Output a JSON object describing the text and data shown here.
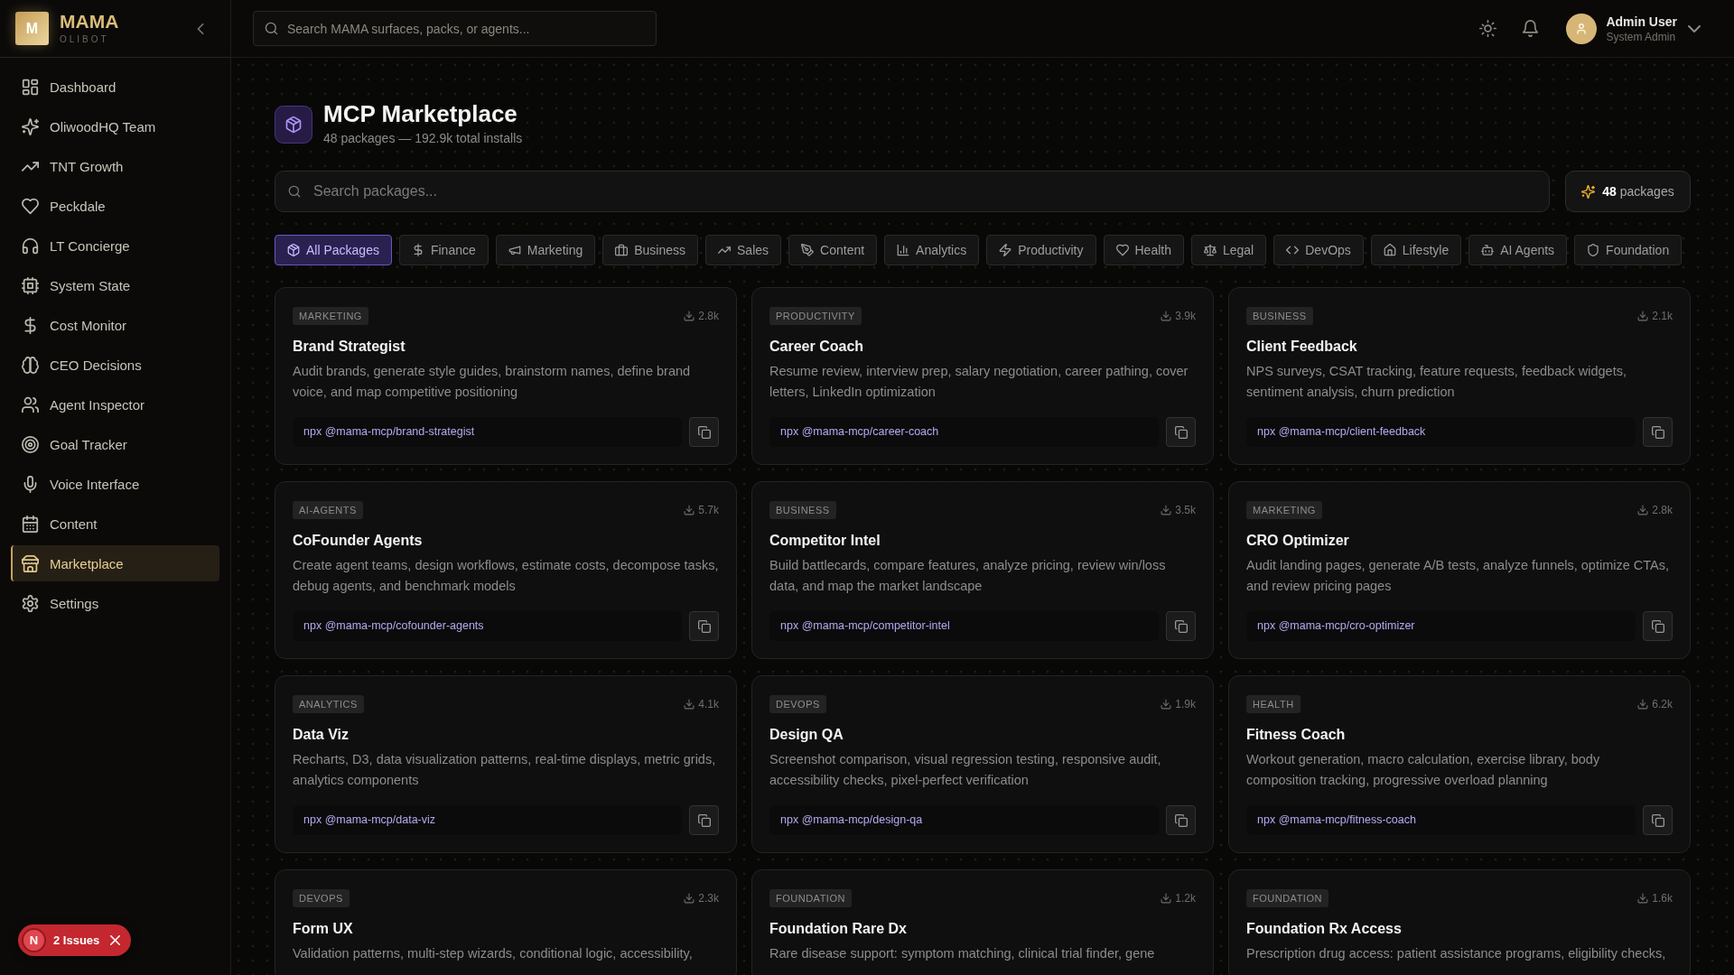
{
  "sidebar": {
    "brand": {
      "logo_letter": "M",
      "name": "MAMA",
      "subtitle": "OLIBOT"
    },
    "items": [
      {
        "label": "Dashboard",
        "selected": false
      },
      {
        "label": "OliwoodHQ Team",
        "selected": false
      },
      {
        "label": "TNT Growth",
        "selected": false
      },
      {
        "label": "Peckdale",
        "selected": false
      },
      {
        "label": "LT Concierge",
        "selected": false
      },
      {
        "label": "System State",
        "selected": false
      },
      {
        "label": "Cost Monitor",
        "selected": false
      },
      {
        "label": "CEO Decisions",
        "selected": false
      },
      {
        "label": "Agent Inspector",
        "selected": false
      },
      {
        "label": "Goal Tracker",
        "selected": false
      },
      {
        "label": "Voice Interface",
        "selected": false
      },
      {
        "label": "Content",
        "selected": false
      },
      {
        "label": "Marketplace",
        "selected": true
      },
      {
        "label": "Settings",
        "selected": false
      }
    ]
  },
  "topbar": {
    "search": {
      "placeholder": "Search MAMA surfaces, packs, or agents..."
    },
    "user": {
      "name": "Admin User",
      "role": "System Admin"
    }
  },
  "page": {
    "title": "MCP Marketplace",
    "subtitle": "48 packages — 192.9k total installs"
  },
  "search": {
    "placeholder": "Search packages..."
  },
  "count_button": "**48** packages",
  "filters": [
    {
      "label": "All Packages",
      "selected": true
    },
    {
      "label": "Finance",
      "selected": false
    },
    {
      "label": "Marketing",
      "selected": false
    },
    {
      "label": "Business",
      "selected": false
    },
    {
      "label": "Sales",
      "selected": false
    },
    {
      "label": "Content",
      "selected": false
    },
    {
      "label": "Analytics",
      "selected": false
    },
    {
      "label": "Productivity",
      "selected": false
    },
    {
      "label": "Health",
      "selected": false
    },
    {
      "label": "Legal",
      "selected": false
    },
    {
      "label": "DevOps",
      "selected": false
    },
    {
      "label": "Lifestyle",
      "selected": false
    },
    {
      "label": "AI Agents",
      "selected": false
    },
    {
      "label": "Foundation",
      "selected": false
    }
  ],
  "packages": [
    {
      "category": "MARKETING",
      "installs": "2.8k",
      "name": "Brand Strategist",
      "description": "Audit brands, generate style guides, brainstorm names, define brand voice, and map competitive positioning",
      "command": "npx @mama-mcp/brand-strategist"
    },
    {
      "category": "PRODUCTIVITY",
      "installs": "3.9k",
      "name": "Career Coach",
      "description": "Resume review, interview prep, salary negotiation, career pathing, cover letters, LinkedIn optimization",
      "command": "npx @mama-mcp/career-coach"
    },
    {
      "category": "BUSINESS",
      "installs": "2.1k",
      "name": "Client Feedback",
      "description": "NPS surveys, CSAT tracking, feature requests, feedback widgets, sentiment analysis, churn prediction",
      "command": "npx @mama-mcp/client-feedback"
    },
    {
      "category": "AI-AGENTS",
      "installs": "5.7k",
      "name": "CoFounder Agents",
      "description": "Create agent teams, design workflows, estimate costs, decompose tasks, debug agents, and benchmark models",
      "command": "npx @mama-mcp/cofounder-agents"
    },
    {
      "category": "BUSINESS",
      "installs": "3.5k",
      "name": "Competitor Intel",
      "description": "Build battlecards, compare features, analyze pricing, review win/loss data, and map the market landscape",
      "command": "npx @mama-mcp/competitor-intel"
    },
    {
      "category": "MARKETING",
      "installs": "2.8k",
      "name": "CRO Optimizer",
      "description": "Audit landing pages, generate A/B tests, analyze funnels, optimize CTAs, and review pricing pages",
      "command": "npx @mama-mcp/cro-optimizer"
    },
    {
      "category": "ANALYTICS",
      "installs": "4.1k",
      "name": "Data Viz",
      "description": "Recharts, D3, data visualization patterns, real-time displays, metric grids, analytics components",
      "command": "npx @mama-mcp/data-viz"
    },
    {
      "category": "DEVOPS",
      "installs": "1.9k",
      "name": "Design QA",
      "description": "Screenshot comparison, visual regression testing, responsive audit, accessibility checks, pixel-perfect verification",
      "command": "npx @mama-mcp/design-qa"
    },
    {
      "category": "HEALTH",
      "installs": "6.2k",
      "name": "Fitness Coach",
      "description": "Workout generation, macro calculation, exercise library, body composition tracking, progressive overload planning",
      "command": "npx @mama-mcp/fitness-coach"
    },
    {
      "category": "DEVOPS",
      "installs": "2.3k",
      "name": "Form UX",
      "description": "Validation patterns, multi-step wizards, conditional logic, accessibility,"
    },
    {
      "category": "FOUNDATION",
      "installs": "1.2k",
      "name": "Foundation Rare Dx",
      "description": "Rare disease support: symptom matching, clinical trial finder, gene"
    },
    {
      "category": "FOUNDATION",
      "installs": "1.6k",
      "name": "Foundation Rx Access",
      "description": "Prescription drug access: patient assistance programs, eligibility checks,"
    }
  ],
  "issues_badge": {
    "logo_letter": "N",
    "label": "2 Issues"
  }
}
